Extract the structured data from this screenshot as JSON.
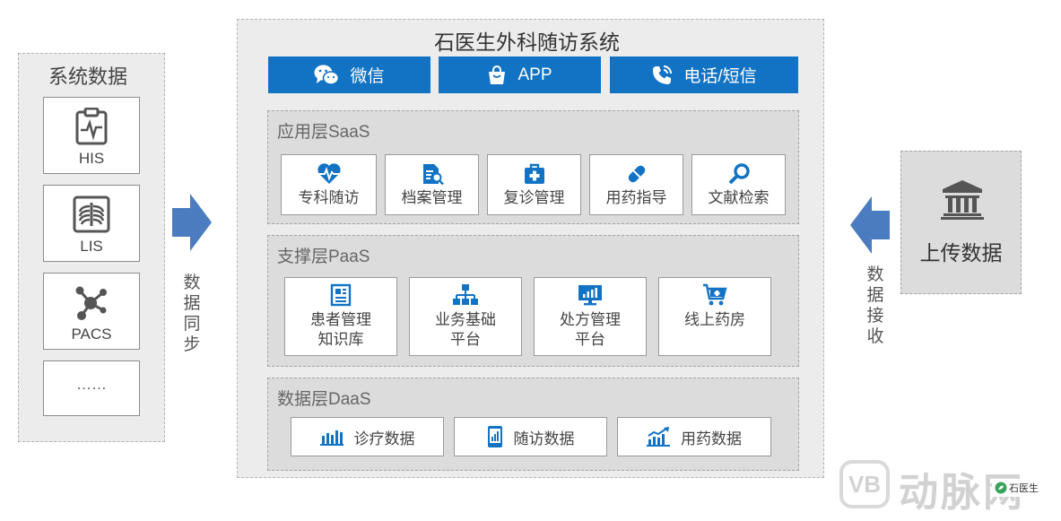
{
  "left_panel": {
    "title": "系统数据",
    "items": [
      {
        "label": "HIS",
        "icon": "clipboard-pulse-icon"
      },
      {
        "label": "LIS",
        "icon": "xray-chest-icon"
      },
      {
        "label": "PACS",
        "icon": "molecule-icon"
      },
      {
        "label": "……",
        "icon": ""
      }
    ]
  },
  "sync_label": "数据同步",
  "main": {
    "title": "石医生外科随访系统",
    "channels": [
      {
        "label": "微信",
        "icon": "wechat-icon"
      },
      {
        "label": "APP",
        "icon": "shopping-bag-icon"
      },
      {
        "label": "电话/短信",
        "icon": "phone-icon"
      }
    ],
    "saas": {
      "title": "应用层SaaS",
      "items": [
        {
          "label": "专科随访",
          "icon": "heart-pulse-icon"
        },
        {
          "label": "档案管理",
          "icon": "document-search-icon"
        },
        {
          "label": "复诊管理",
          "icon": "medical-kit-icon"
        },
        {
          "label": "用药指导",
          "icon": "pill-icon"
        },
        {
          "label": "文献检索",
          "icon": "magnifier-icon"
        }
      ]
    },
    "paas": {
      "title": "支撑层PaaS",
      "items": [
        {
          "line1": "患者管理",
          "line2": "知识库",
          "icon": "news-document-icon"
        },
        {
          "line1": "业务基础",
          "line2": "平台",
          "icon": "org-chart-icon"
        },
        {
          "line1": "处方管理",
          "line2": "平台",
          "icon": "monitor-chart-icon"
        },
        {
          "line1": "线上药房",
          "line2": "",
          "icon": "cart-plus-icon"
        }
      ]
    },
    "daas": {
      "title": "数据层DaaS",
      "items": [
        {
          "label": "诊疗数据",
          "icon": "bar-chart-icon"
        },
        {
          "label": "随访数据",
          "icon": "mobile-chart-icon"
        },
        {
          "label": "用药数据",
          "icon": "trend-chart-icon"
        }
      ]
    }
  },
  "right_box": {
    "label": "上传数据",
    "icon": "bank-building-icon"
  },
  "receive_label": "数据接收",
  "watermark": {
    "text": "动脉网",
    "logo_text": "VB",
    "brand": "石医生"
  },
  "colors": {
    "accent": "#1273c4",
    "arrow": "#4a7cbf",
    "panel": "#ececed",
    "layer": "#dcdcdd"
  }
}
